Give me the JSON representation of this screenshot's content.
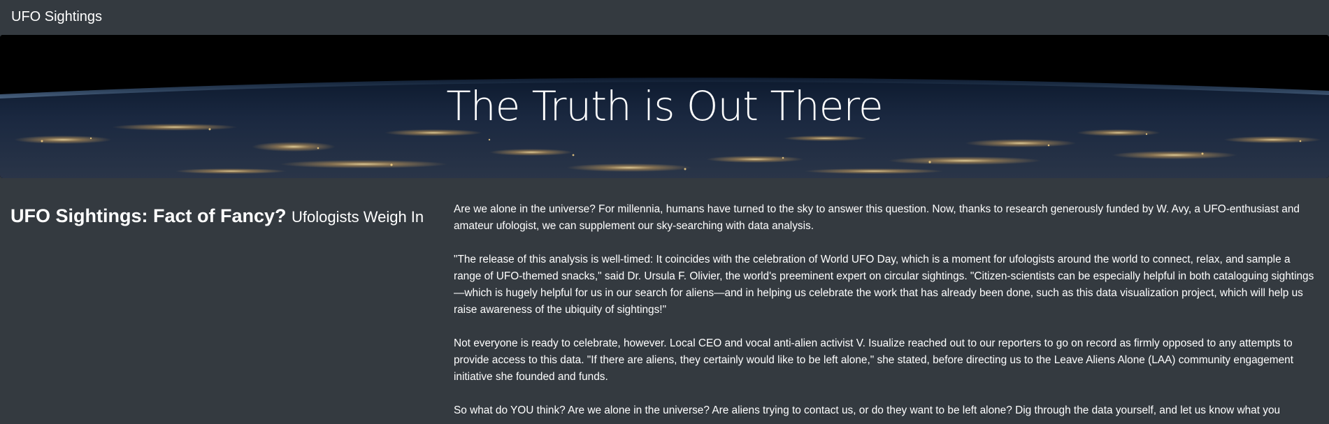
{
  "navbar": {
    "brand": "UFO Sightings"
  },
  "hero": {
    "title": "The Truth is Out There"
  },
  "article": {
    "headline": "UFO Sightings: Fact of Fancy?",
    "subheadline": "Ufologists Weigh In",
    "paragraphs": [
      "Are we alone in the universe? For millennia, humans have turned to the sky to answer this question. Now, thanks to research generously funded by W. Avy, a UFO-enthusiast and amateur ufologist, we can supplement our sky-searching with data analysis.",
      "\"The release of this analysis is well-timed: It coincides with the celebration of World UFO Day, which is a moment for ufologists around the world to connect, relax, and sample a range of UFO-themed snacks,\" said Dr. Ursula F. Olivier, the world's preeminent expert on circular sightings. \"Citizen-scientists can be especially helpful in both cataloguing sightings—which is hugely helpful for us in our search for aliens—and in helping us celebrate the work that has already been done, such as this data visualization project, which will help us raise awareness of the ubiquity of sightings!\"",
      "Not everyone is ready to celebrate, however. Local CEO and vocal anti-alien activist V. Isualize reached out to our reporters to go on record as firmly opposed to any attempts to provide access to this data. \"If there are aliens, they certainly would like to be left alone,\" she stated, before directing us to the Leave Aliens Alone (LAA) community engagement initiative she founded and funds.",
      "So what do YOU think? Are we alone in the universe? Are aliens trying to contact us, or do they want to be left alone? Dig through the data yourself, and let us know what you"
    ]
  },
  "colors": {
    "background": "#343a40",
    "text": "#ffffff"
  }
}
